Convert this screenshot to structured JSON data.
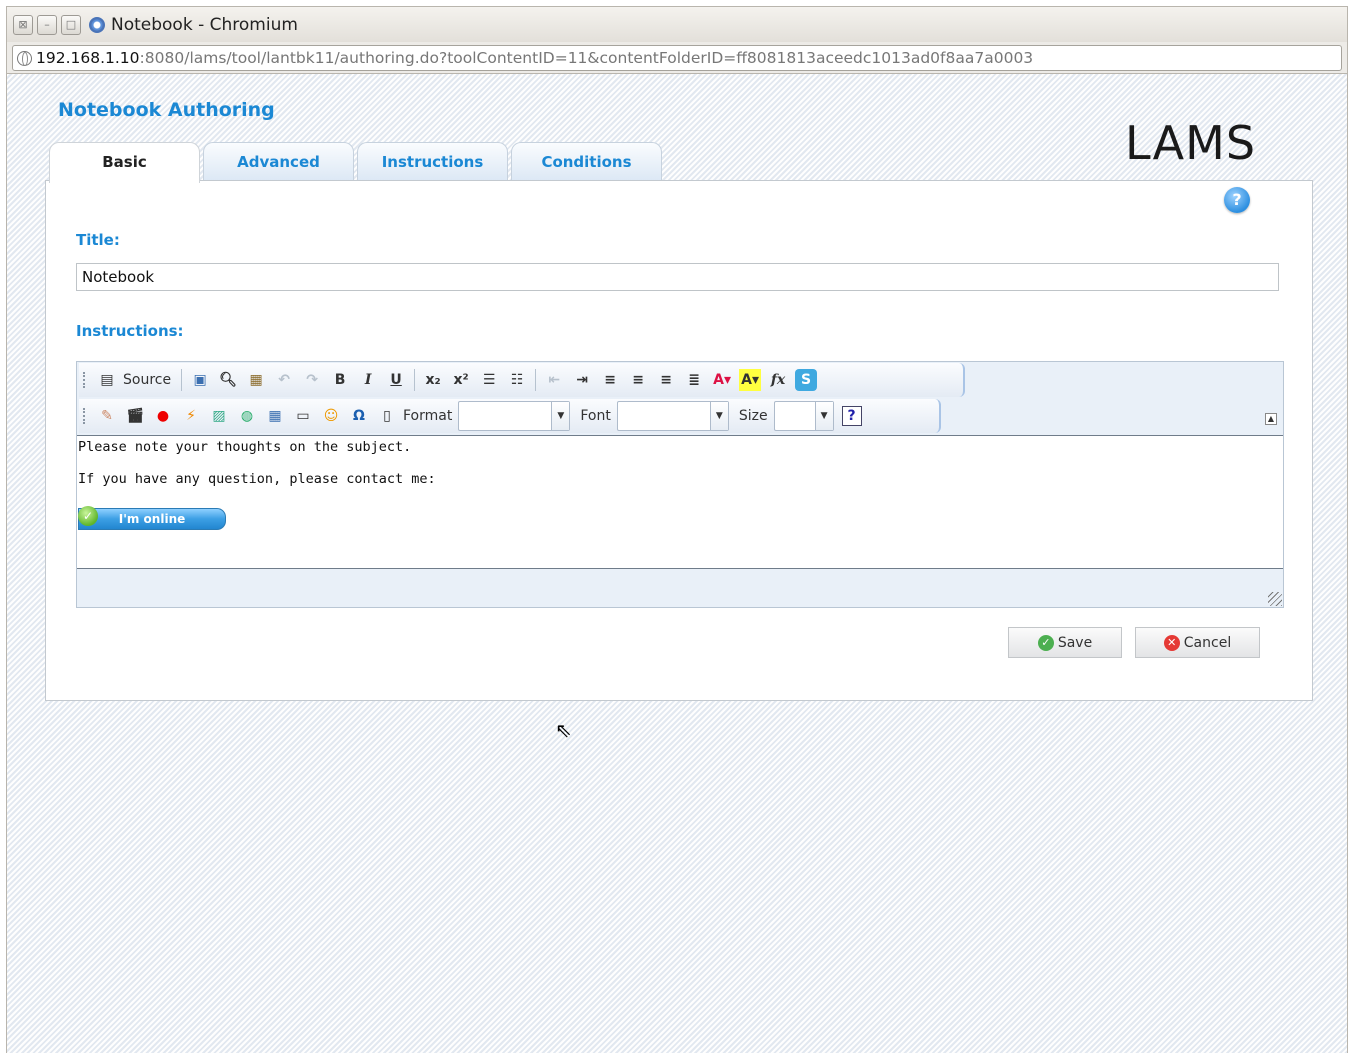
{
  "window": {
    "title": "Notebook - Chromium",
    "close_glyph": "⊠",
    "minimize_glyph": "–",
    "maximize_glyph": "□"
  },
  "address": {
    "host": "192.168.1.10",
    "rest": ":8080/lams/tool/lantbk11/authoring.do?toolContentID=11&contentFolderID=ff8081813aceedc1013ad0f8aa7a0003"
  },
  "page": {
    "heading": "Notebook Authoring",
    "logo": "LAMS",
    "help_glyph": "?"
  },
  "tabs": [
    {
      "label": "Basic",
      "active": true
    },
    {
      "label": "Advanced",
      "active": false
    },
    {
      "label": "Instructions",
      "active": false
    },
    {
      "label": "Conditions",
      "active": false
    }
  ],
  "form": {
    "title_label": "Title:",
    "title_value": "Notebook",
    "instructions_label": "Instructions:"
  },
  "toolbar": {
    "source_label": "Source",
    "format_label": "Format",
    "font_label": "Font",
    "size_label": "Size"
  },
  "editor": {
    "line1": "Please note your thoughts on the subject.",
    "line2": "If you have any question, please contact me:",
    "status_button": "I'm online"
  },
  "actions": {
    "save_label": "Save",
    "cancel_label": "Cancel"
  },
  "colors": {
    "accent": "#1b88d4",
    "save_icon": "#4caf50",
    "cancel_icon": "#e53935"
  }
}
